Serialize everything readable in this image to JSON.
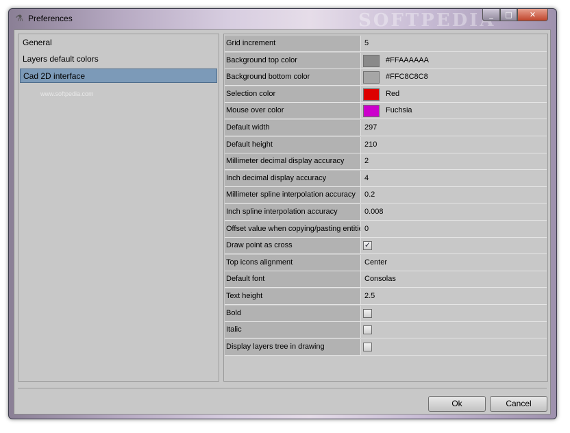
{
  "window": {
    "title": "Preferences",
    "watermark": "SOFTPEDIA",
    "controls": {
      "minimize": "_",
      "maximize": "□",
      "close": "✕"
    }
  },
  "nav": {
    "items": [
      {
        "label": "General",
        "selected": false
      },
      {
        "label": "Layers default colors",
        "selected": false
      },
      {
        "label": "Cad 2D interface",
        "selected": true
      }
    ],
    "watermark": "www.softpedia.com"
  },
  "properties": [
    {
      "label": "Grid increment",
      "type": "text",
      "value": "5"
    },
    {
      "label": "Background top color",
      "type": "color",
      "value": "#FFAAAAAA",
      "color": "#8a8a8a"
    },
    {
      "label": "Background bottom color",
      "type": "color",
      "value": "#FFC8C8C8",
      "color": "#a6a6a6"
    },
    {
      "label": "Selection color",
      "type": "color",
      "value": "Red",
      "color": "#dd0000"
    },
    {
      "label": "Mouse over color",
      "type": "color",
      "value": "Fuchsia",
      "color": "#cc00cc"
    },
    {
      "label": "Default width",
      "type": "text",
      "value": "297"
    },
    {
      "label": "Default height",
      "type": "text",
      "value": "210"
    },
    {
      "label": "Millimeter decimal display accuracy",
      "type": "text",
      "value": "2"
    },
    {
      "label": "Inch decimal display accuracy",
      "type": "text",
      "value": "4"
    },
    {
      "label": "Millimeter spline interpolation accuracy",
      "type": "text",
      "value": "0.2"
    },
    {
      "label": "Inch spline interpolation accuracy",
      "type": "text",
      "value": "0.008"
    },
    {
      "label": "Offset value when copying/pasting entities",
      "type": "text",
      "value": "0"
    },
    {
      "label": "Draw point as cross",
      "type": "check",
      "checked": true
    },
    {
      "label": "Top icons alignment",
      "type": "text",
      "value": "Center"
    },
    {
      "label": "Default font",
      "type": "text",
      "value": "Consolas"
    },
    {
      "label": "Text height",
      "type": "text",
      "value": "2.5"
    },
    {
      "label": "Bold",
      "type": "check",
      "checked": false
    },
    {
      "label": "Italic",
      "type": "check",
      "checked": false
    },
    {
      "label": "Display layers tree in drawing",
      "type": "check",
      "checked": false
    }
  ],
  "buttons": {
    "ok": "Ok",
    "cancel": "Cancel"
  }
}
